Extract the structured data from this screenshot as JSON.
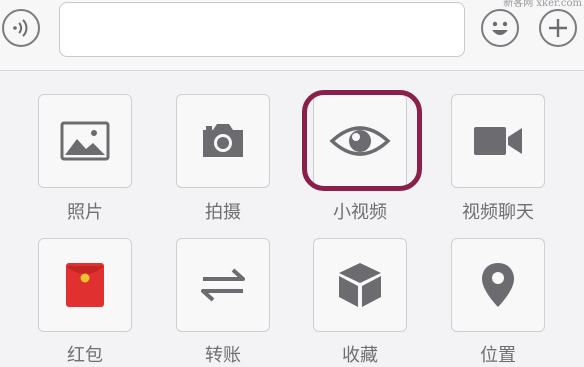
{
  "watermark": "新客网 xker.com",
  "input": {
    "value": "",
    "placeholder": ""
  },
  "grid": {
    "items": [
      {
        "label": "照片",
        "icon": "photo-icon"
      },
      {
        "label": "拍摄",
        "icon": "camera-icon"
      },
      {
        "label": "小视频",
        "icon": "eye-icon"
      },
      {
        "label": "视频聊天",
        "icon": "video-camera-icon"
      },
      {
        "label": "红包",
        "icon": "red-envelope-icon"
      },
      {
        "label": "转账",
        "icon": "transfer-arrows-icon"
      },
      {
        "label": "收藏",
        "icon": "cube-icon"
      },
      {
        "label": "位置",
        "icon": "location-pin-icon"
      }
    ]
  },
  "colors": {
    "icon_gray": "#6b6b70",
    "highlight": "#8a1f4a",
    "red_envelope": "#e0302f",
    "envelope_seal": "#f2c12e"
  }
}
